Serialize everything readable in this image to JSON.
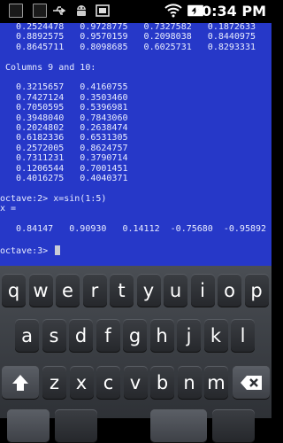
{
  "status_bar": {
    "time": "10:34 PM",
    "left_icons": [
      "checkbox-icon",
      "checkbox-icon",
      "usb-icon",
      "android-debug-icon",
      "screenshot-icon"
    ],
    "right_icons": [
      "wifi-icon",
      "battery-charging-icon"
    ]
  },
  "terminal": {
    "lines": [
      "   0.2524478   0.9728775   0.7327582   0.1872633",
      "   0.8892575   0.9570159   0.2098038   0.8440975",
      "   0.8645711   0.8098685   0.6025731   0.8293331",
      "",
      " Columns 9 and 10:",
      "",
      "   0.3215657   0.4160755",
      "   0.7427124   0.3503460",
      "   0.7050595   0.5396981",
      "   0.3948040   0.7843060",
      "   0.2024802   0.2638474",
      "   0.6182336   0.6531305",
      "   0.2572005   0.8624757",
      "   0.7311231   0.3790714",
      "   0.1206544   0.7001451",
      "   0.4016275   0.4040371",
      "",
      "octave:2> x=sin(1:5)",
      "x =",
      "",
      "   0.84147   0.90930   0.14112  -0.75680  -0.95892",
      "",
      "octave:3> "
    ]
  },
  "keyboard": {
    "row1": [
      "q",
      "w",
      "e",
      "r",
      "t",
      "y",
      "u",
      "i",
      "o",
      "p"
    ],
    "row2": [
      "a",
      "s",
      "d",
      "f",
      "g",
      "h",
      "j",
      "k",
      "l"
    ],
    "row3": [
      "z",
      "x",
      "c",
      "v",
      "b",
      "n",
      "m"
    ],
    "shift_icon": "shift-arrow-icon",
    "delete_icon": "backspace-icon"
  },
  "colors": {
    "terminal_bg": "#2638c8",
    "terminal_text": "#e8ecff"
  }
}
